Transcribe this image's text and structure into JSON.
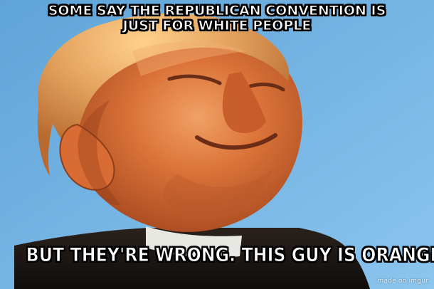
{
  "meme": {
    "top_text": "SOME SAY THE REPUBLICAN CONVENTION IS JUST FOR WHITE PEOPLE",
    "bottom_text": "BUT THEY'RE WRONG.  THIS GUY IS ORANGE.",
    "watermark": "made on imgur"
  },
  "colors": {
    "sky": "#7cb8e4",
    "skin_orange": "#d96a2a",
    "hair_blond": "#e8a55b",
    "suit_dark": "#1c1814",
    "caption_white": "#ffffff",
    "caption_outline": "#000000"
  }
}
